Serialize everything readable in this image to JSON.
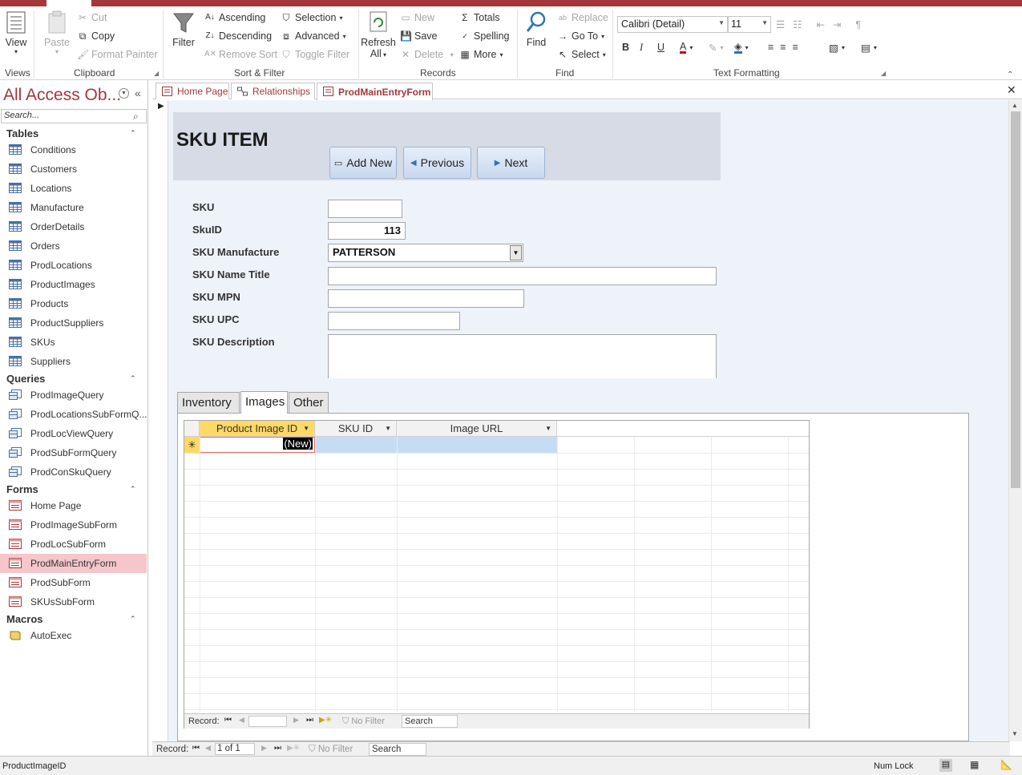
{
  "ribbon": {
    "views": {
      "view": "View",
      "group": "Views"
    },
    "clipboard": {
      "paste": "Paste",
      "cut": "Cut",
      "copy": "Copy",
      "format_painter": "Format Painter",
      "group": "Clipboard"
    },
    "sort_filter": {
      "filter": "Filter",
      "ascending": "Ascending",
      "descending": "Descending",
      "remove_sort": "Remove Sort",
      "selection": "Selection",
      "advanced": "Advanced",
      "toggle_filter": "Toggle Filter",
      "group": "Sort & Filter"
    },
    "records": {
      "refresh": "Refresh",
      "refresh_all": "All",
      "new": "New",
      "save": "Save",
      "delete": "Delete",
      "totals": "Totals",
      "spelling": "Spelling",
      "more": "More",
      "group": "Records"
    },
    "find": {
      "find": "Find",
      "replace": "Replace",
      "goto": "Go To",
      "select": "Select",
      "group": "Find"
    },
    "text_formatting": {
      "font": "Calibri (Detail)",
      "size": "11",
      "bold": "B",
      "italic": "I",
      "underline": "U",
      "group": "Text Formatting"
    }
  },
  "nav": {
    "title": "All Access Ob...",
    "search_placeholder": "Search...",
    "sections": {
      "tables": "Tables",
      "queries": "Queries",
      "forms": "Forms",
      "macros": "Macros"
    },
    "tables": [
      "Conditions",
      "Customers",
      "Locations",
      "Manufacture",
      "OrderDetails",
      "Orders",
      "ProdLocations",
      "ProductImages",
      "Products",
      "ProductSuppliers",
      "SKUs",
      "Suppliers"
    ],
    "queries": [
      "ProdImageQuery",
      "ProdLocationsSubFormQ...",
      "ProdLocViewQuery",
      "ProdSubFormQuery",
      "ProdConSkuQuery"
    ],
    "forms": [
      "Home Page",
      "ProdImageSubForm",
      "ProdLocSubForm",
      "ProdMainEntryForm",
      "ProdSubForm",
      "SKUsSubForm"
    ],
    "macros": [
      "AutoExec"
    ]
  },
  "doc_tabs": [
    "Home Page",
    "Relationships",
    "ProdMainEntryForm"
  ],
  "form": {
    "title": "SKU ITEM",
    "buttons": {
      "add_new": "Add New",
      "previous": "Previous",
      "next": "Next"
    },
    "labels": {
      "sku": "SKU",
      "skuid": "SkuID",
      "manufacture": "SKU Manufacture",
      "name_title": "SKU Name Title",
      "mpn": "SKU MPN",
      "upc": "SKU UPC",
      "description": "SKU Description"
    },
    "values": {
      "sku": "",
      "skuid": "113",
      "manufacture": "PATTERSON",
      "name_title": "",
      "mpn": "",
      "upc": "",
      "description": ""
    },
    "tabs": [
      "Inventory",
      "Images",
      "Other"
    ]
  },
  "subgrid": {
    "columns": [
      "Product Image ID",
      "SKU ID",
      "Image URL"
    ],
    "new_row": "(New)",
    "record_label": "Record:",
    "no_filter": "No Filter",
    "search": "Search"
  },
  "outer_record": {
    "label": "Record:",
    "position": "1 of 1",
    "no_filter": "No Filter",
    "search": "Search"
  },
  "status": {
    "left": "ProductImageID",
    "num_lock": "Num Lock"
  },
  "colors": {
    "accent": "#a4373a",
    "header_bg": "#d6dbe6",
    "form_bg": "#eef3fa",
    "selection": "#f5c6cb",
    "column_highlight": "#ffd966"
  }
}
